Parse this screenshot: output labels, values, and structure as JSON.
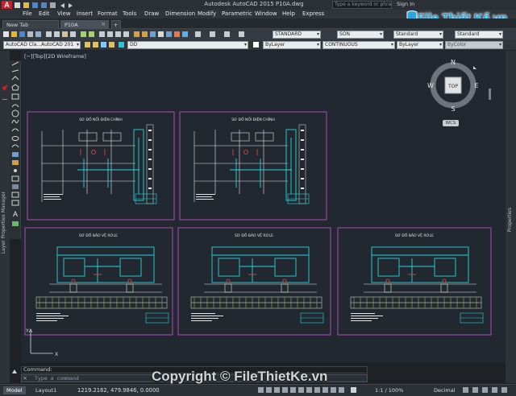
{
  "titlebar": {
    "app_logo": "A",
    "title": "Autodesk AutoCAD 2015    P10A.dwg",
    "search_placeholder": "Type a keyword or phrase",
    "signin": "Sign In"
  },
  "menubar": {
    "items": [
      "File",
      "Edit",
      "View",
      "Insert",
      "Format",
      "Tools",
      "Draw",
      "Dimension",
      "Modify",
      "Parametric",
      "Window",
      "Help",
      "Express"
    ]
  },
  "tabs": [
    {
      "label": "New Tab"
    },
    {
      "label": "P10A"
    }
  ],
  "toolbar": {
    "textstyle": "STANDARD",
    "dimstyle": "SON",
    "tablestyle": "Standard",
    "mleaderstyle": "Standard",
    "workspace": "AutoCAD Cla...AutoCAD 201",
    "layer": "DD",
    "color": "ByLayer",
    "linetype": "CONTINUOUS",
    "lineweight": "ByLayer",
    "plotstyle": "ByColor"
  },
  "viewport": {
    "label": "[−][Top][2D Wireframe]"
  },
  "viewcube": {
    "north": "N",
    "south": "S",
    "east": "E",
    "west": "W",
    "face": "TOP",
    "wcs": "WCS"
  },
  "panels": {
    "left_label": "Layer Properties Manager",
    "right_label": "Properties"
  },
  "sheets": {
    "top_title": "SƠ ĐỒ NỐI ĐIỆN CHÍNH",
    "bottom_title": "SƠ ĐỒ BẢO VỆ RƠLE"
  },
  "command": {
    "history": "Command:",
    "placeholder": "Type a command"
  },
  "statusbar": {
    "tabs": [
      "Model",
      "Layout1"
    ],
    "coords": "1219.2162, 479.9846, 0.0000",
    "scale": "1:1 / 100%",
    "units": "Decimal"
  },
  "watermark": {
    "logo": "File Thiết Kế.vn",
    "copyright": "Copyright © FileThietKe.vn"
  },
  "colors": {
    "canvas": "#212830",
    "sheet_border": "#b04ab8",
    "cyan": "#27d4e0",
    "accent_red": "#c8202a",
    "brand_blue": "#29a8e0"
  }
}
